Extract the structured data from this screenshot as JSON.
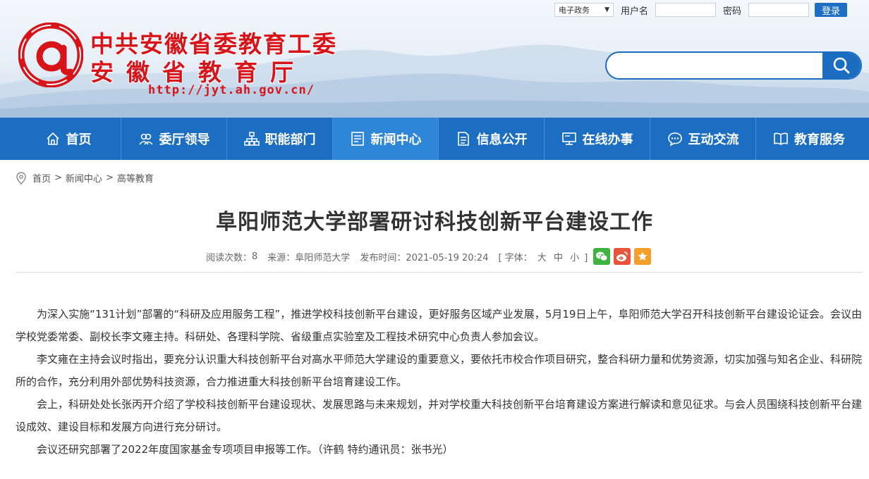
{
  "header": {
    "org_name": "中共安徽省委教育工委",
    "dept_name": "安徽省教育厅",
    "url_text": "http://jyt.ah.gov.cn/",
    "login": {
      "system_select": "电子政务",
      "username_label": "用户名",
      "username_value": "",
      "password_label": "密码",
      "password_value": "",
      "login_button": "登录"
    },
    "search": {
      "placeholder": "",
      "value": "",
      "icon": "search-icon"
    }
  },
  "nav": {
    "items": [
      {
        "label": "首页",
        "icon": "home-icon"
      },
      {
        "label": "委厅领导",
        "icon": "leaders-icon"
      },
      {
        "label": "职能部门",
        "icon": "org-chart-icon"
      },
      {
        "label": "新闻中心",
        "icon": "news-icon",
        "active": true
      },
      {
        "label": "信息公开",
        "icon": "document-icon"
      },
      {
        "label": "在线办事",
        "icon": "monitor-icon"
      },
      {
        "label": "互动交流",
        "icon": "chat-icon"
      },
      {
        "label": "教育服务",
        "icon": "book-icon"
      }
    ],
    "colors": {
      "bar": "#1b6ec2",
      "active": "#2f86d8"
    }
  },
  "breadcrumb": {
    "items": [
      "首页",
      "新闻中心",
      "高等教育"
    ],
    "separator": ">"
  },
  "article": {
    "title": "阜阳师范大学部署研讨科技创新平台建设工作",
    "meta": {
      "read_label": "阅读次数：",
      "read_count": "8",
      "source": "来源：阜阳师范大学",
      "publish": "发布时间：2021-05-19 20:24",
      "font_open": "[ 字体：",
      "font_large": "大",
      "font_medium": "中",
      "font_small": "小",
      "font_close": "]"
    },
    "share": [
      "wechat-icon",
      "weibo-icon",
      "favorite-icon"
    ],
    "paragraphs": [
      "为深入实施“131计划”部署的“科研及应用服务工程”，推进学校科技创新平台建设，更好服务区域产业发展，5月19日上午，阜阳师范大学召开科技创新平台建设论证会。会议由学校党委常委、副校长李文雍主持。科研处、各理科学院、省级重点实验室及工程技术研究中心负责人参加会议。",
      "李文雍在主持会议时指出，要充分认识重大科技创新平台对高水平师范大学建设的重要意义，要依托市校合作项目研究，整合科研力量和优势资源，切实加强与知名企业、科研院所的合作，充分利用外部优势科技资源，合力推进重大科技创新平台培育建设工作。",
      "会上，科研处处长张丙开介绍了学校科技创新平台建设现状、发展思路与未来规划，并对学校重大科技创新平台培育建设方案进行解读和意见征求。与会人员围绕科技创新平台建设成效、建设目标和发展方向进行充分研讨。",
      "会议还研究部署了2022年度国家基金专项项目申报等工作。（许鹤 特约通讯员：张书光）"
    ]
  }
}
